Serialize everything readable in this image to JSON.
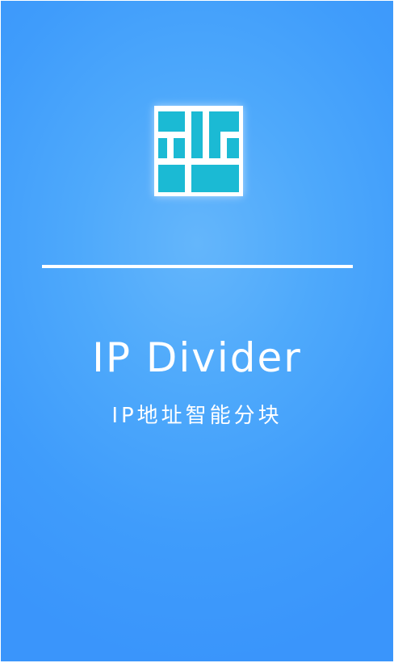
{
  "splash": {
    "logo_icon": "ip-block-grid-icon",
    "title": "IP Divider",
    "subtitle": "IP地址智能分块"
  },
  "colors": {
    "background": "#4ea9fb",
    "logo_tile": "#1bbad4",
    "text": "#ffffff"
  }
}
